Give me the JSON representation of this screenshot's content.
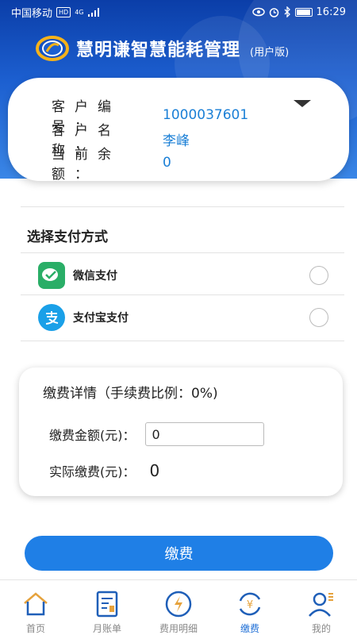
{
  "status_bar": {
    "carrier": "中国移动",
    "hd_badge": "HD",
    "net": "4G",
    "time": "16:29"
  },
  "app": {
    "title": "慧明谦智慧能耗管理",
    "subtitle": "(用户版)"
  },
  "customer": {
    "number_label": "客户编号：",
    "number_value": "1000037601",
    "name_label": "客户名称：",
    "name_value": "李峰",
    "balance_label": "当前余额：",
    "balance_value": "0"
  },
  "payment": {
    "section_title": "选择支付方式",
    "options": [
      {
        "label": "微信支付",
        "icon": "wechat-icon",
        "selected": false
      },
      {
        "label": "支付宝支付",
        "icon": "alipay-icon",
        "selected": false
      }
    ]
  },
  "detail": {
    "title": "缴费详情（手续费比例：0%)",
    "amount_label": "缴费金额(元)：",
    "amount_value": "0",
    "actual_label": "实际缴费(元)：",
    "actual_value": "0"
  },
  "pay_button": "缴费",
  "nav": [
    {
      "label": "首页",
      "icon": "home-icon"
    },
    {
      "label": "月账单",
      "icon": "monthly-bill-icon"
    },
    {
      "label": "费用明细",
      "icon": "cost-detail-icon"
    },
    {
      "label": "缴费",
      "icon": "payment-icon",
      "active": true
    },
    {
      "label": "我的",
      "icon": "profile-icon"
    }
  ],
  "colors": {
    "primary": "#1f7fe6",
    "header_dark": "#0b3ea8",
    "value_blue": "#1a7fd6",
    "wechat_green": "#2aae67",
    "alipay_blue": "#1aa0e8"
  }
}
